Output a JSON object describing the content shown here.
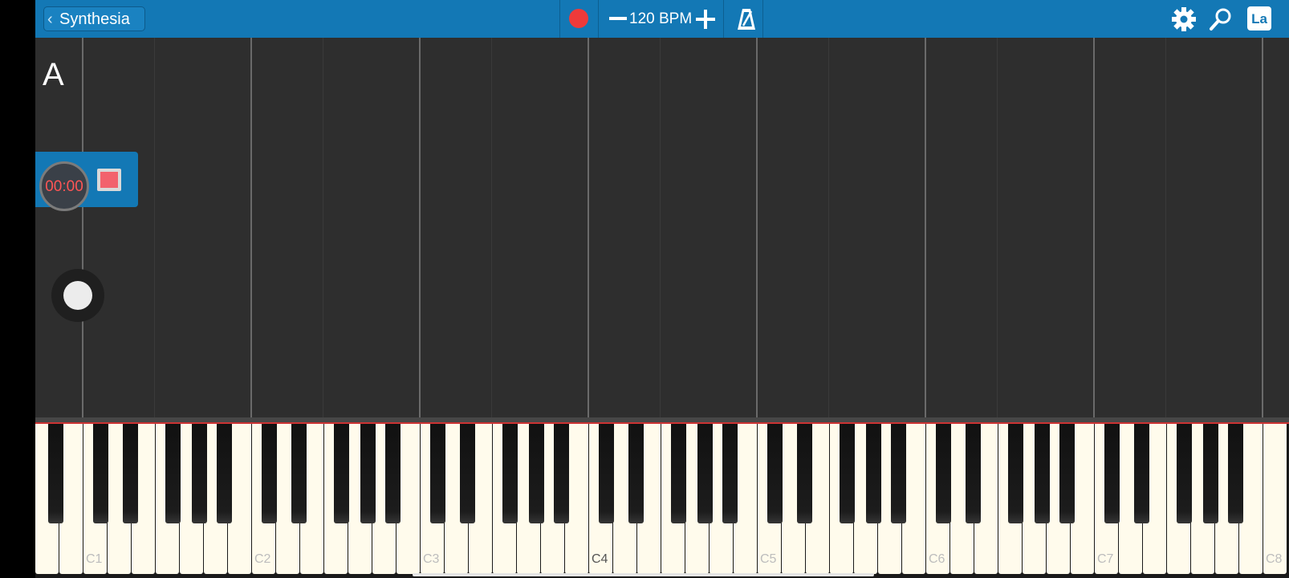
{
  "topbar": {
    "back_label": "Synthesia",
    "bpm_label": "120 BPM",
    "label_mode": "La",
    "icons": [
      "chevron-left-icon",
      "record-icon",
      "minus-icon",
      "plus-icon",
      "metronome-icon",
      "gear-icon",
      "search-icon",
      "note-label-icon"
    ],
    "colors": {
      "bar": "#1378b5",
      "record": "#ee3a3a"
    }
  },
  "note_area": {
    "hand_label": "A",
    "timer": "00:00"
  },
  "keyboard": {
    "octave_labels": [
      "C1",
      "C2",
      "C3",
      "C4",
      "C5",
      "C6",
      "C7",
      "C8"
    ],
    "white_key_count": 52
  }
}
